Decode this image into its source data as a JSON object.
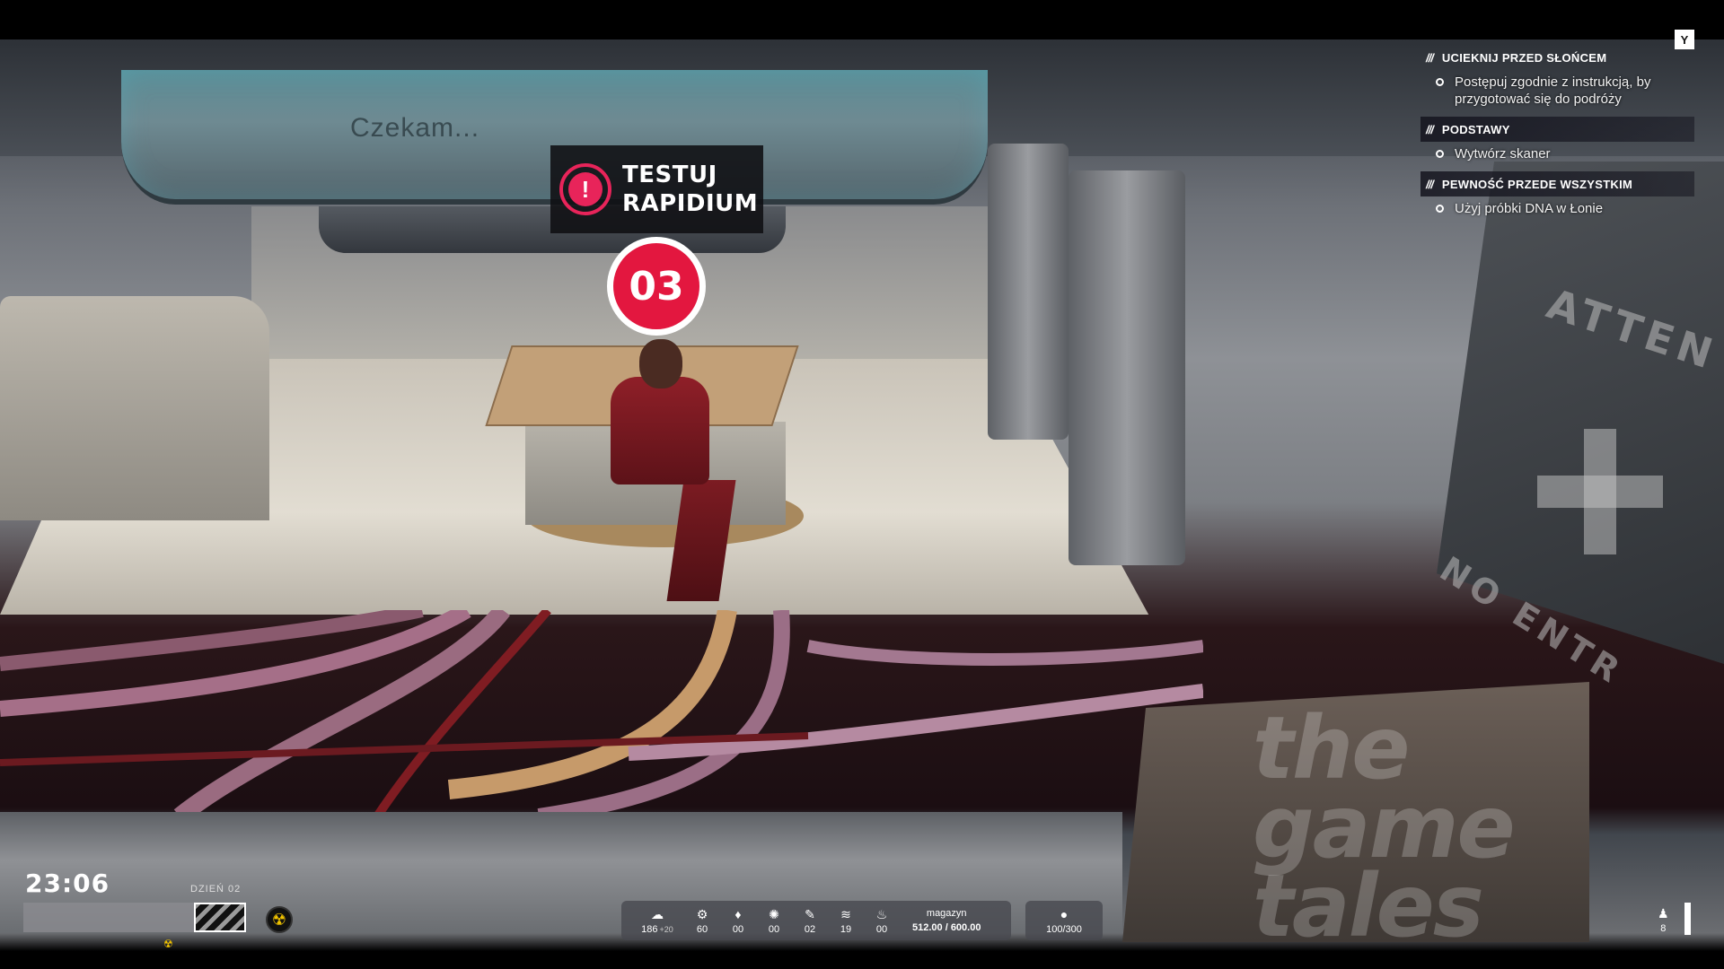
{
  "scene": {
    "monitor_text": "Czekam...",
    "wall_text_top": "ATTEN",
    "wall_text_bottom": "NO ENTR"
  },
  "objective_popup": {
    "icon": "alert-icon",
    "line1": "TESTUJ",
    "line2": "RAPIDIUM",
    "accent": "#e8245a"
  },
  "marker": {
    "number": "03",
    "color": "#e3173f"
  },
  "quest_log": {
    "key_hint": "Y",
    "quests": [
      {
        "title": "UCIEKNIJ PRZED SŁOŃCEM",
        "tasks": [
          "Postępuj zgodnie z instrukcją, by przygotować się do podróży"
        ]
      },
      {
        "title": "PODSTAWY",
        "tasks": [
          "Wytwórz skaner"
        ]
      },
      {
        "title": "PEWNOŚĆ PRZEDE WSZYSTKIM",
        "tasks": [
          "Użyj próbki DNA w Łonie"
        ]
      }
    ]
  },
  "hud": {
    "clock": "23:06",
    "day_label": "DZIEŃ 02",
    "resources": [
      {
        "icon": "food-icon",
        "glyph": "☁",
        "value": "186",
        "delta": "+20"
      },
      {
        "icon": "gear-icon",
        "glyph": "⚙",
        "value": "60"
      },
      {
        "icon": "crystal-icon",
        "glyph": "♦",
        "value": "00"
      },
      {
        "icon": "ore-icon",
        "glyph": "✺",
        "value": "00"
      },
      {
        "icon": "tool-icon",
        "glyph": "✎",
        "value": "02"
      },
      {
        "icon": "ration-icon",
        "glyph": "≋",
        "value": "19"
      },
      {
        "icon": "bowl-icon",
        "glyph": "♨",
        "value": "00"
      }
    ],
    "storage": {
      "label": "magazyn",
      "value": "512.00 / 600.00"
    },
    "water": {
      "icon": "water-drop-icon",
      "glyph": "💧",
      "value": "100/300"
    },
    "population": {
      "icon": "colonist-icon",
      "glyph": "♟",
      "value": "8"
    }
  },
  "watermark": {
    "line1": "the",
    "line2": "game",
    "line3": "tales"
  }
}
